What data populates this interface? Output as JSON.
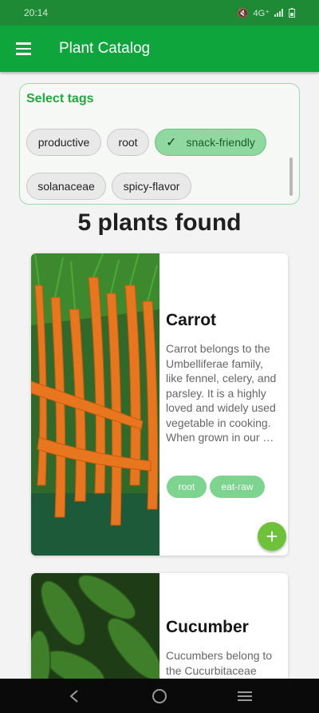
{
  "status_bar": {
    "time": "20:14",
    "network": "4G⁺"
  },
  "app_bar": {
    "title": "Plant Catalog",
    "menu_icon": "hamburger-menu-icon"
  },
  "tags": {
    "title": "Select tags",
    "chips": [
      {
        "label": "productive",
        "selected": false
      },
      {
        "label": "root",
        "selected": false
      },
      {
        "label": "snack-friendly",
        "selected": true
      },
      {
        "label": "solanaceae",
        "selected": false
      },
      {
        "label": "spicy-flavor",
        "selected": false
      }
    ]
  },
  "results": {
    "count_text": "5 plants found"
  },
  "plants": [
    {
      "name": "Carrot",
      "description": "Carrot belongs to the Umbelliferae family, like fennel, celery, and parsley. It is a highly loved and widely used vegetable in cooking. When grown in our …",
      "tags": [
        "root",
        "eat-raw"
      ],
      "image_icon": "carrot-photo"
    },
    {
      "name": "Cucumber",
      "description": "Cucumbers belong to the Cucurbitaceae",
      "image_icon": "cucumber-photo"
    }
  ],
  "colors": {
    "primary": "#0fa53d",
    "chip_selected": "#8fd89f",
    "tag_pill": "#7cd48e",
    "fab": "#6dc23a"
  }
}
